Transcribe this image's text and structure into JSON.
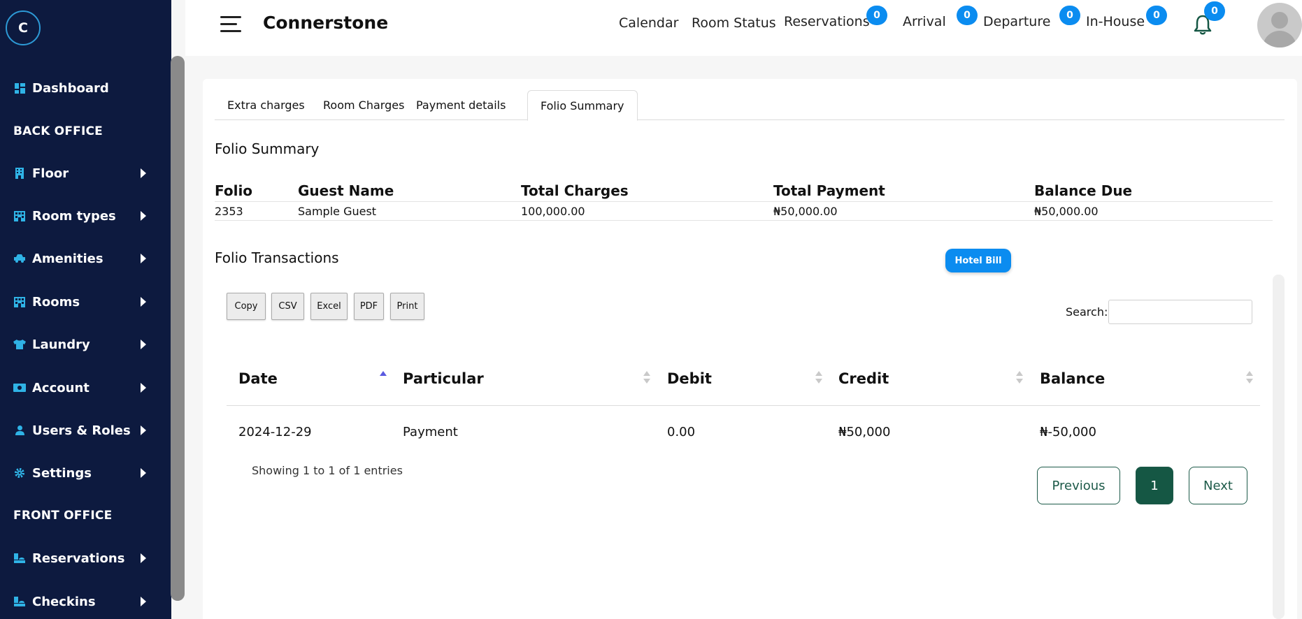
{
  "sidebar": {
    "logo": "C",
    "items": [
      {
        "label": "Dashboard"
      },
      {
        "label": "Floor"
      },
      {
        "label": "Room types"
      },
      {
        "label": "Amenities"
      },
      {
        "label": "Rooms"
      },
      {
        "label": "Laundry"
      },
      {
        "label": "Account"
      },
      {
        "label": "Users & Roles"
      },
      {
        "label": "Settings"
      },
      {
        "label": "Reservations"
      },
      {
        "label": "Checkins"
      }
    ],
    "sections": {
      "back_office": "BACK OFFICE",
      "front_office": "FRONT OFFICE"
    }
  },
  "header": {
    "brand": "Connerstone",
    "nav": {
      "calendar": "Calendar",
      "room_status": "Room Status",
      "reservations": "Reservations",
      "arrival": "Arrival",
      "departure": "Departure",
      "in_house": "In-House"
    },
    "badges": {
      "reservations": "0",
      "arrival": "0",
      "departure": "0",
      "in_house": "0",
      "notifications": "0"
    },
    "accent": "#0b8cf0"
  },
  "tabs": {
    "extra_charges": "Extra charges",
    "room_charges": "Room Charges",
    "payment_details": "Payment details",
    "folio_summary": "Folio Summary"
  },
  "summary": {
    "title": "Folio Summary",
    "headers": {
      "folio": "Folio",
      "guest_name": "Guest Name",
      "total_charges": "Total Charges",
      "total_payment": "Total Payment",
      "balance_due": "Balance Due"
    },
    "row": {
      "folio": "2353",
      "guest_name": "Sample Guest",
      "total_charges": "100,000.00",
      "total_payment": "₦50,000.00",
      "balance_due": "₦50,000.00"
    }
  },
  "transactions": {
    "title": "Folio Transactions",
    "hotel_bill": "Hotel Bill",
    "export": {
      "copy": "Copy",
      "csv": "CSV",
      "excel": "Excel",
      "pdf": "PDF",
      "print": "Print"
    },
    "search_label": "Search:",
    "search_value": "",
    "headers": {
      "date": "Date",
      "particular": "Particular",
      "debit": "Debit",
      "credit": "Credit",
      "balance": "Balance"
    },
    "row": {
      "date": "2024-12-29",
      "particular": "Payment",
      "debit": "0.00",
      "credit": "₦50,000",
      "balance": "₦-50,000"
    },
    "info": "Showing 1 to 1 of 1 entries",
    "pagination": {
      "previous": "Previous",
      "page": "1",
      "next": "Next"
    }
  }
}
